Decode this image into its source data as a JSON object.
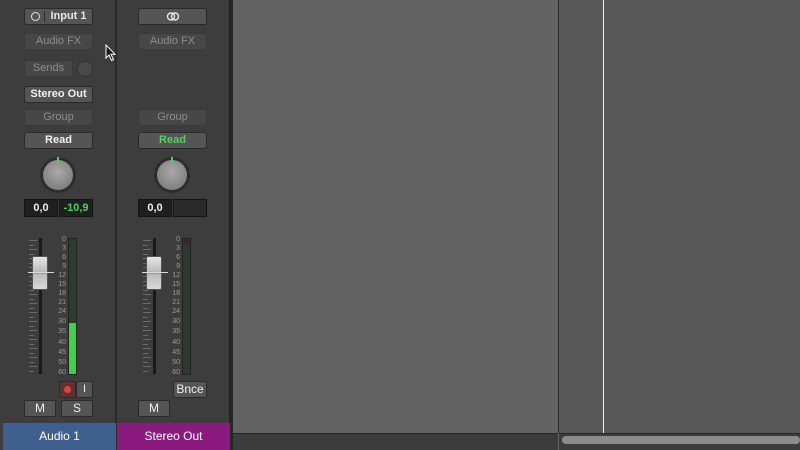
{
  "colors": {
    "strip_bg": "#3d3d3d",
    "arrange_bg": "#636363",
    "audio_track_color": "#3f5f8f",
    "output_track_color": "#8b1a7e",
    "meter_green": "#3fd14d",
    "read_green": "#52d15a"
  },
  "strip1": {
    "input_label": "Input 1",
    "input_icon": "circle-icon",
    "audio_fx": "Audio FX",
    "sends": "Sends",
    "output": "Stereo Out",
    "group": "Group",
    "automation": "Read",
    "volume_value": "0,0",
    "peak_value": "-10,9",
    "meter_level_percent": 38,
    "mute": "M",
    "solo": "S",
    "record_icon": "record-icon",
    "input_monitor": "I",
    "name": "Audio 1"
  },
  "strip2": {
    "link_icon": "stereo-link-icon",
    "audio_fx": "Audio FX",
    "group": "Group",
    "automation": "Read",
    "volume_value": "0,0",
    "peak_value": "",
    "bounce": "Bnce",
    "mute": "M",
    "name": "Stereo Out"
  },
  "db_scale": [
    "0",
    "3",
    "6",
    "9",
    "12",
    "15",
    "18",
    "21",
    "24",
    "30",
    "35",
    "40",
    "45",
    "50",
    "60"
  ]
}
